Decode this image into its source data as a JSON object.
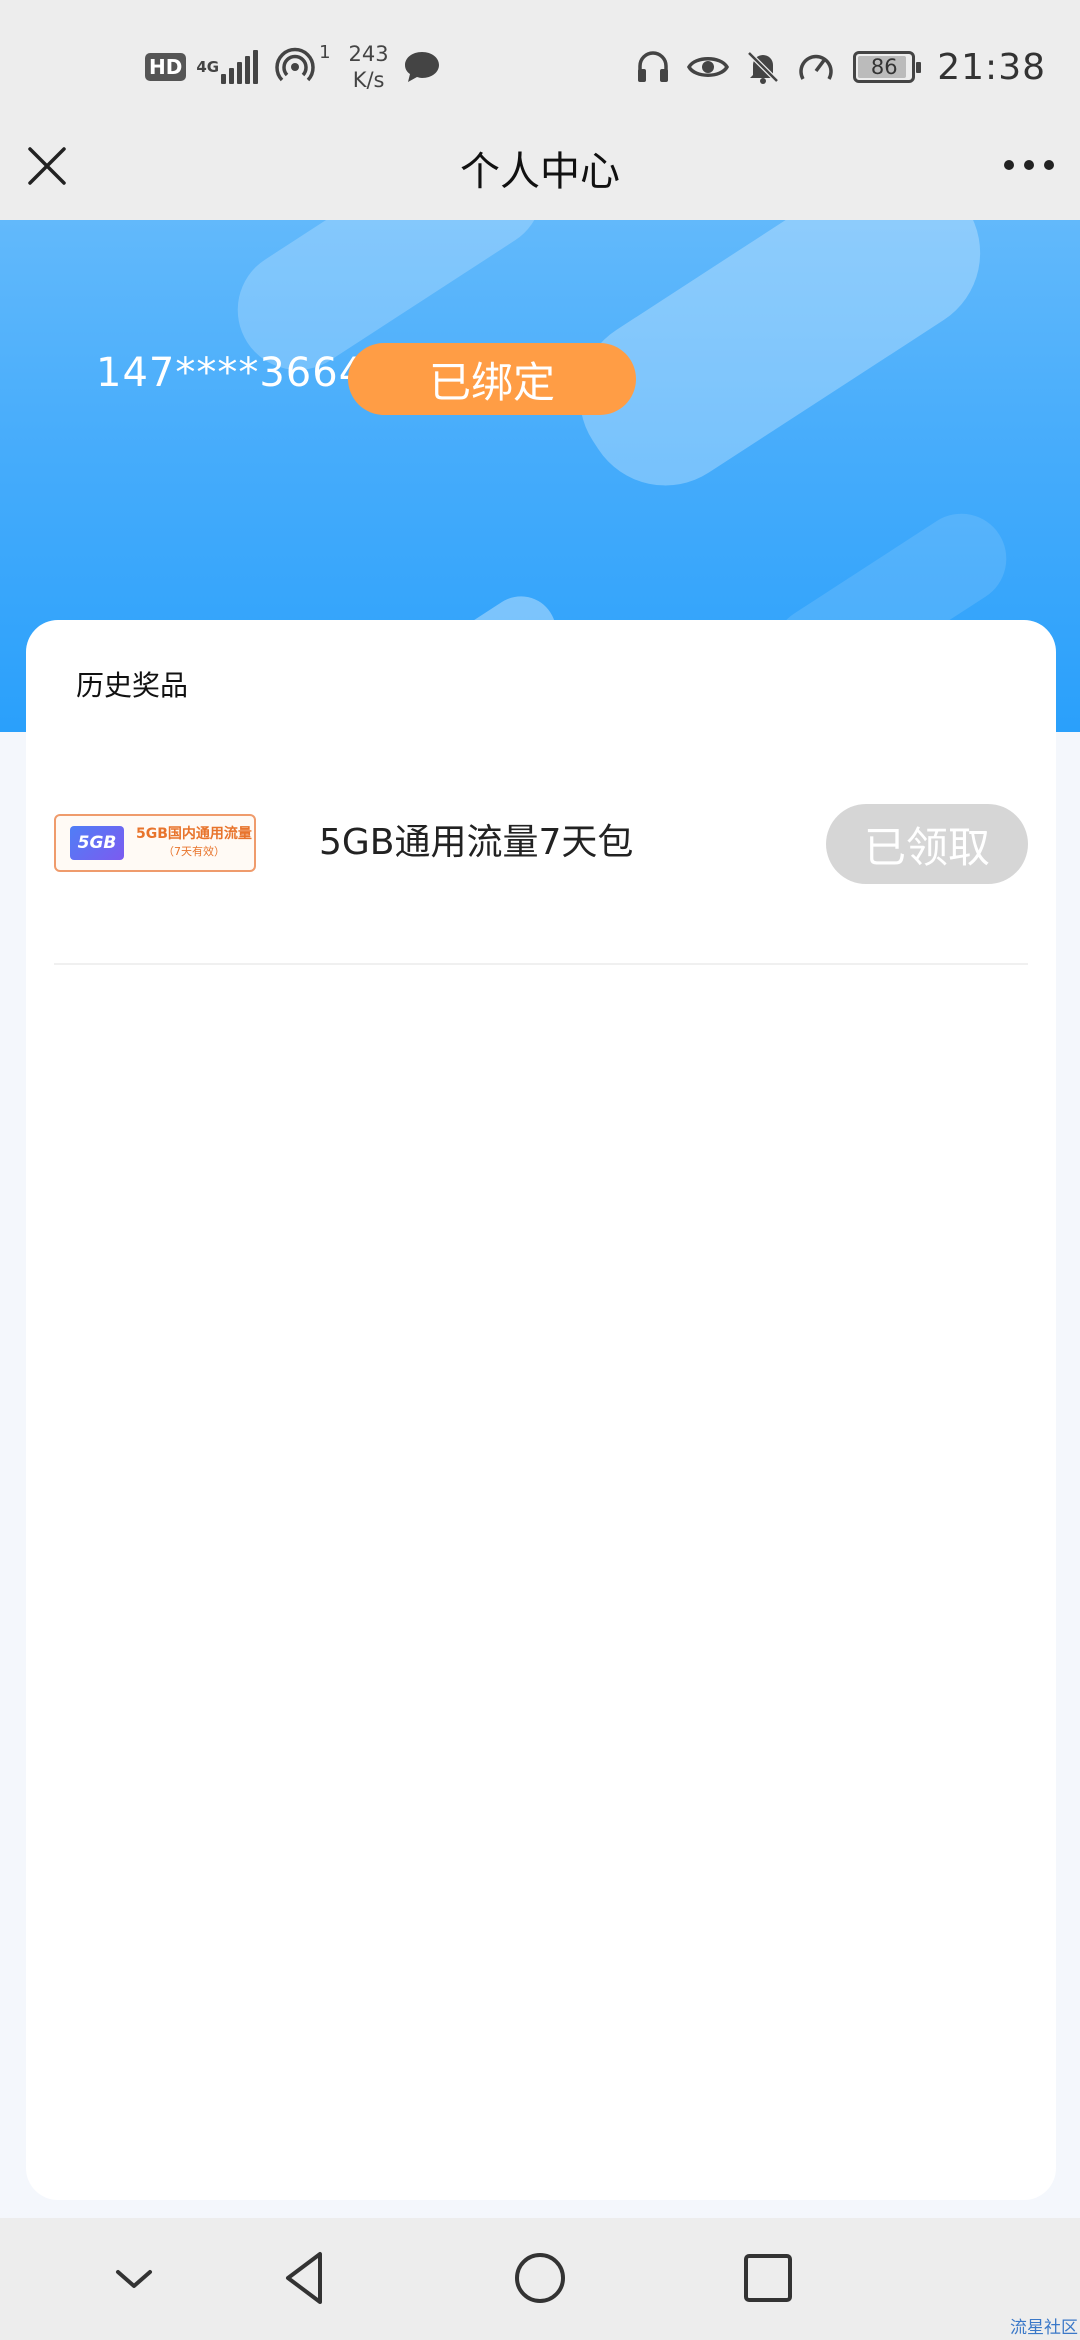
{
  "status_bar": {
    "hd": "HD",
    "network": "4G",
    "hotspot_count": "1",
    "speed_value": "243",
    "speed_unit": "K/s",
    "battery": "86",
    "time": "21:38"
  },
  "nav": {
    "title": "个人中心"
  },
  "banner": {
    "phone": "147****3664",
    "bound_label": "已绑定"
  },
  "card": {
    "title": "历史奖品",
    "prizes": [
      {
        "thumb_badge": "5GB",
        "thumb_line1": "5GB国内通用流量",
        "thumb_line2": "（7天有效）",
        "name": "5GB通用流量7天包",
        "action": "已领取"
      }
    ]
  },
  "watermark": "流星社区",
  "colors": {
    "accent_orange": "#ff9d45",
    "banner_blue": "#2aa0fb",
    "disabled_gray": "#d6d6d6"
  },
  "icons": [
    "close-icon",
    "more-icon",
    "headphones-icon",
    "eye-icon",
    "bell-off-icon",
    "speedometer-icon",
    "back-chevron-icon",
    "back-triangle-icon",
    "home-circle-icon",
    "recent-square-icon"
  ]
}
